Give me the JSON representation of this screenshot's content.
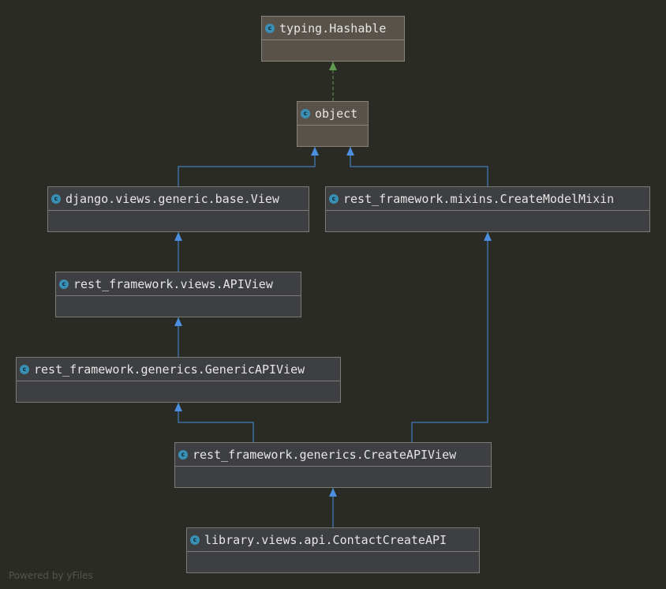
{
  "classes": [
    {
      "id": "hashable",
      "label": "typing.Hashable",
      "kind": "builtin",
      "icon": "class-icon",
      "icon_glyph": "c"
    },
    {
      "id": "object",
      "label": "object",
      "kind": "builtin",
      "icon": "class-icon",
      "icon_glyph": "c"
    },
    {
      "id": "view",
      "label": "django.views.generic.base.View",
      "kind": "class",
      "icon": "class-icon",
      "icon_glyph": "c"
    },
    {
      "id": "createmodelmixin",
      "label": "rest_framework.mixins.CreateModelMixin",
      "kind": "class",
      "icon": "class-icon",
      "icon_glyph": "c"
    },
    {
      "id": "apiview",
      "label": "rest_framework.views.APIView",
      "kind": "class",
      "icon": "class-icon",
      "icon_glyph": "c"
    },
    {
      "id": "genericapiview",
      "label": "rest_framework.generics.GenericAPIView",
      "kind": "class",
      "icon": "class-icon",
      "icon_glyph": "c"
    },
    {
      "id": "createapiview",
      "label": "rest_framework.generics.CreateAPIView",
      "kind": "class",
      "icon": "class-icon",
      "icon_glyph": "c"
    },
    {
      "id": "contactcreateapi",
      "label": "library.views.api.ContactCreateAPI",
      "kind": "class",
      "icon": "class-icon",
      "icon_glyph": "c"
    }
  ],
  "edges": [
    {
      "from": "object",
      "to": "hashable",
      "type": "implements"
    },
    {
      "from": "view",
      "to": "object",
      "type": "extends"
    },
    {
      "from": "createmodelmixin",
      "to": "object",
      "type": "extends"
    },
    {
      "from": "apiview",
      "to": "view",
      "type": "extends"
    },
    {
      "from": "genericapiview",
      "to": "apiview",
      "type": "extends"
    },
    {
      "from": "createapiview",
      "to": "genericapiview",
      "type": "extends"
    },
    {
      "from": "createapiview",
      "to": "createmodelmixin",
      "type": "extends"
    },
    {
      "from": "contactcreateapi",
      "to": "createapiview",
      "type": "extends"
    }
  ],
  "colors": {
    "extends": "#4a8fe0",
    "implements": "#5e9a4e"
  },
  "footer": "Powered by yFiles"
}
